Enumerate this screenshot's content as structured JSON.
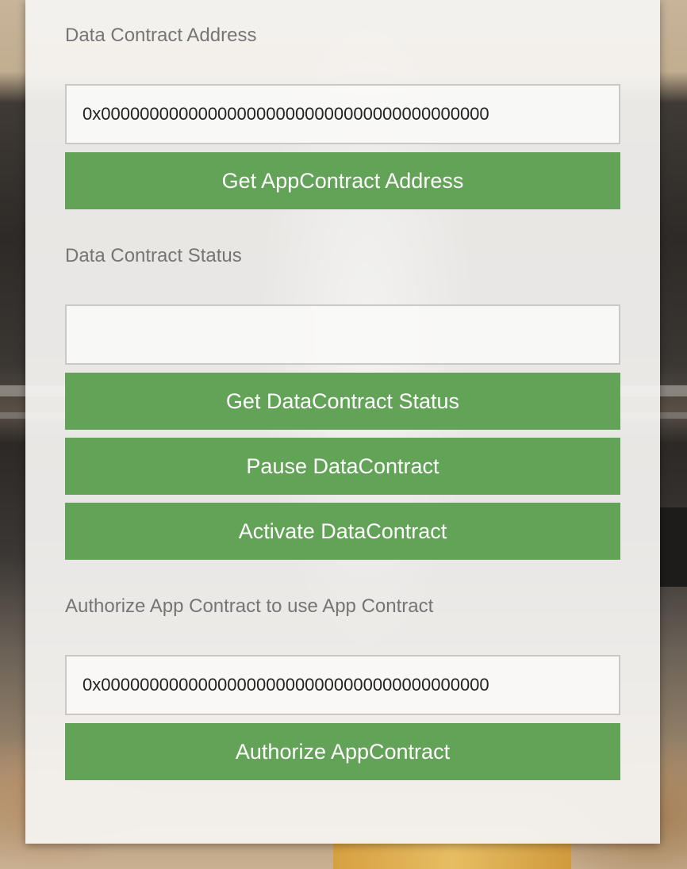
{
  "colors": {
    "button_bg": "#63a357",
    "button_text": "#ffffff",
    "label_text": "#757575",
    "input_border": "#c9c9c9"
  },
  "data_contract_address": {
    "label": "Data Contract Address",
    "input_value": "0x0000000000000000000000000000000000000000",
    "button_label": "Get AppContract Address"
  },
  "data_contract_status": {
    "label": "Data Contract Status",
    "input_value": "",
    "get_status_button_label": "Get DataContract Status",
    "pause_button_label": "Pause DataContract",
    "activate_button_label": "Activate DataContract"
  },
  "authorize_app_contract": {
    "label": "Authorize App Contract to use App Contract",
    "input_value": "0x0000000000000000000000000000000000000000",
    "button_label": "Authorize AppContract"
  }
}
